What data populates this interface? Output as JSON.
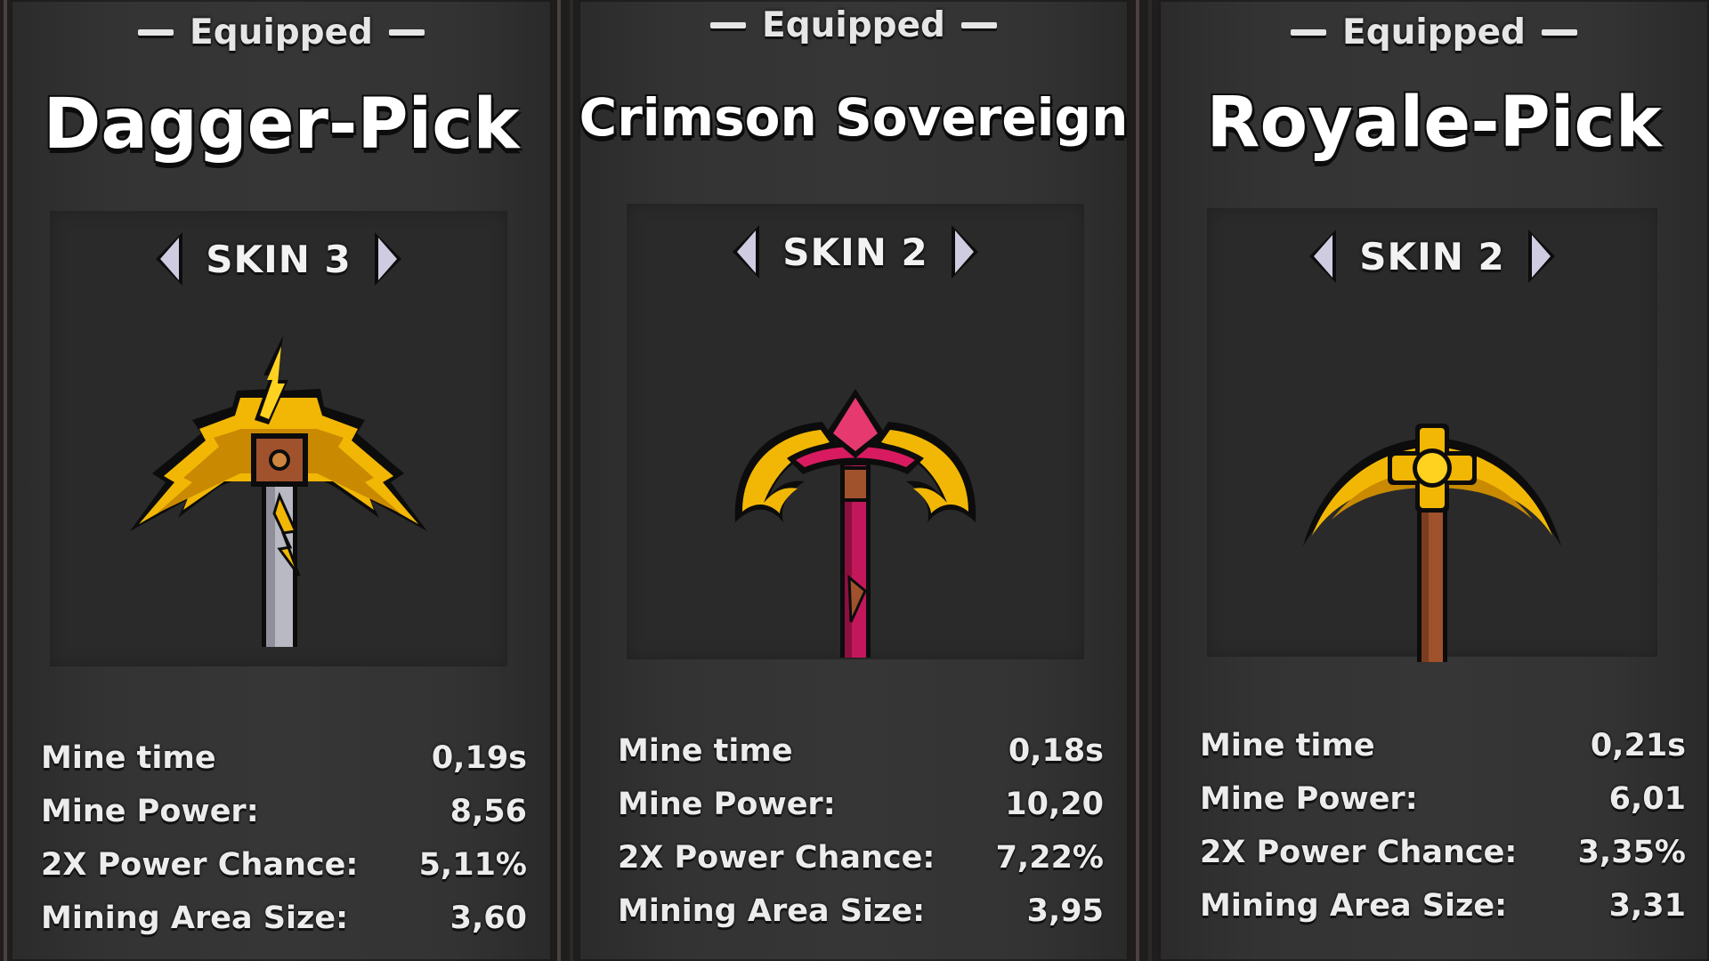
{
  "cards": [
    {
      "equipped_label": "Equipped",
      "name": "Dagger-Pick",
      "skin_label": "SKIN 3",
      "pickaxe_icon": "lightning-pickaxe-icon",
      "stats": [
        {
          "label": "Mine time",
          "value": "0,19s"
        },
        {
          "label": "Mine Power:",
          "value": "8,56"
        },
        {
          "label": "2X Power Chance:",
          "value": "5,11%"
        },
        {
          "label": "Mining Area Size:",
          "value": "3,60"
        }
      ]
    },
    {
      "equipped_label": "Equipped",
      "name": "Crimson Sovereign",
      "skin_label": "SKIN 2",
      "pickaxe_icon": "crimson-pickaxe-icon",
      "stats": [
        {
          "label": "Mine time",
          "value": "0,18s"
        },
        {
          "label": "Mine Power:",
          "value": "10,20"
        },
        {
          "label": "2X Power Chance:",
          "value": "7,22%"
        },
        {
          "label": "Mining Area Size:",
          "value": "3,95"
        }
      ]
    },
    {
      "equipped_label": "Equipped",
      "name": "Royale-Pick",
      "skin_label": "SKIN 2",
      "pickaxe_icon": "royal-golden-pickaxe-icon",
      "stats": [
        {
          "label": "Mine time",
          "value": "0,21s"
        },
        {
          "label": "Mine Power:",
          "value": "6,01"
        },
        {
          "label": "2X Power Chance:",
          "value": "3,35%"
        },
        {
          "label": "Mining Area Size:",
          "value": "3,31"
        }
      ]
    }
  ],
  "colors": {
    "card_bg": "#333333",
    "preview_bg": "#2a2a2a",
    "text": "#ececec",
    "gold": "#f5c518",
    "crimson": "#c2185b",
    "wood": "#a0522d"
  }
}
